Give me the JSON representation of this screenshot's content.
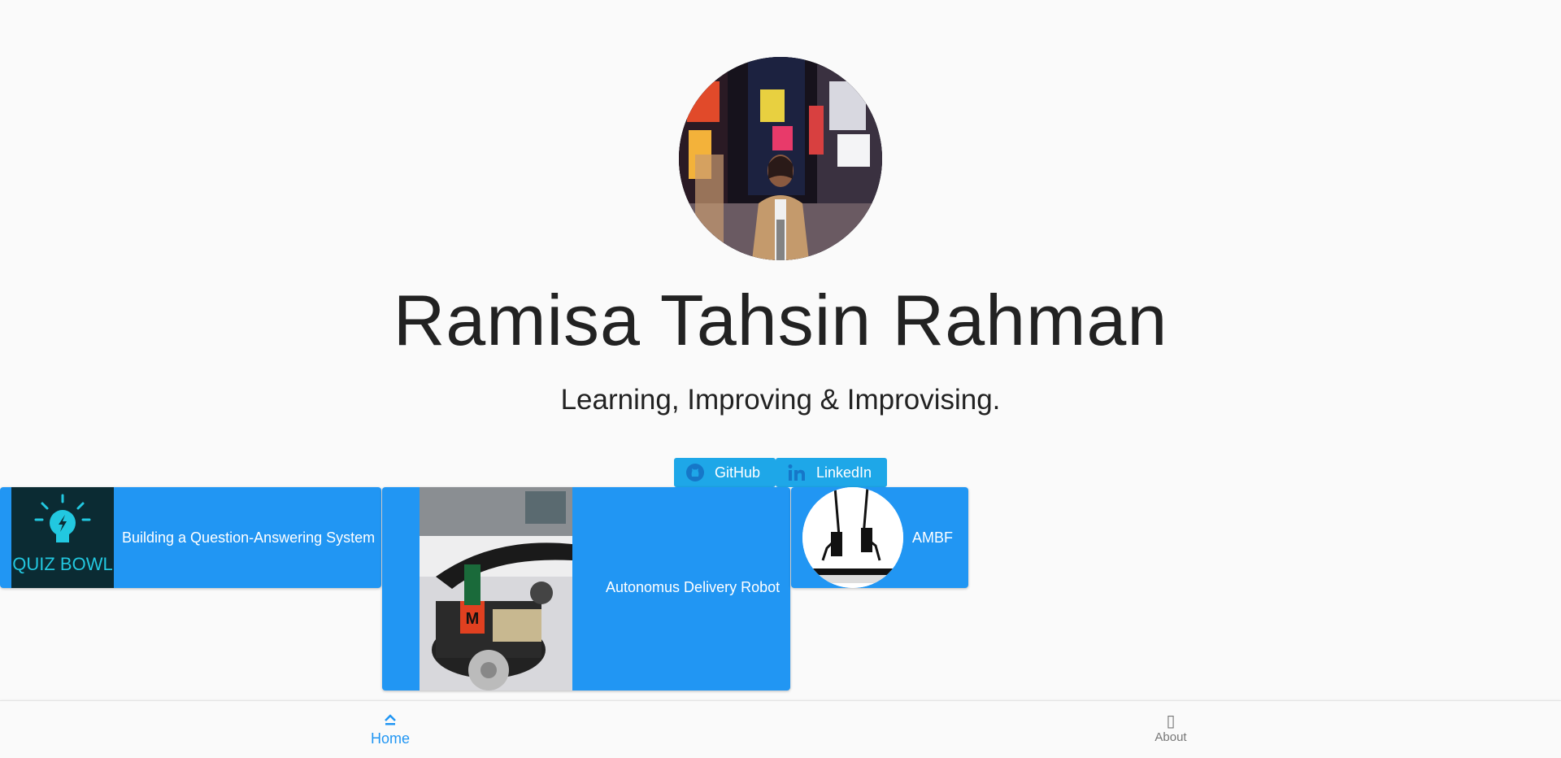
{
  "profile": {
    "name": "Ramisa Tahsin Rahman",
    "tagline": "Learning, Improving & Improvising."
  },
  "social": {
    "github_label": "GitHub",
    "linkedin_label": "LinkedIn"
  },
  "projects": [
    {
      "label": "Building a Question-Answering System",
      "thumb_text_1": "QUIZ BOWL"
    },
    {
      "label": "Autonomus Delivery Robot",
      "thumb_text_1": "M"
    },
    {
      "label": "AMBF"
    }
  ],
  "nav": {
    "home_label": "Home",
    "about_label": "About",
    "home_icon": "chevron-up-icon",
    "about_icon": "missing-glyph-icon",
    "about_glyph": "▯"
  },
  "colors": {
    "accent": "#2196f3",
    "social_button": "#1ea7e8",
    "background": "#fafafa",
    "text": "#222222"
  }
}
